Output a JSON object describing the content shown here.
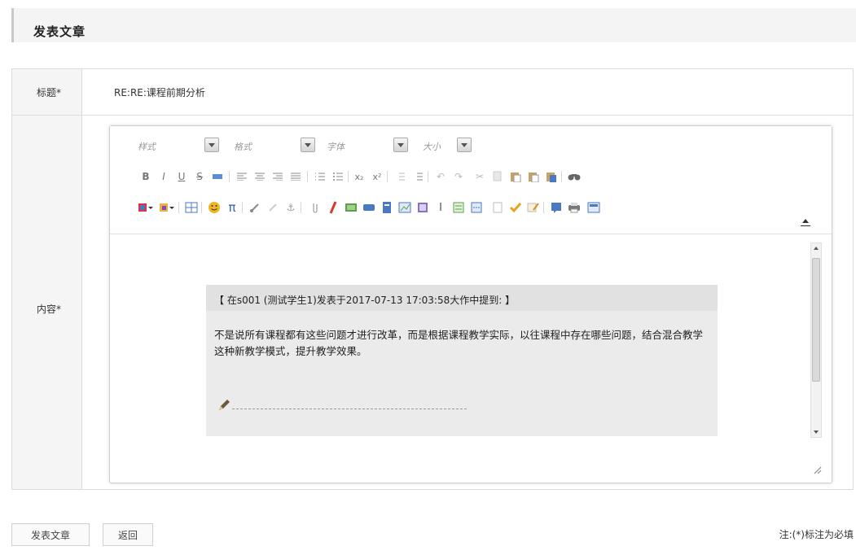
{
  "header": {
    "title": "发表文章"
  },
  "form": {
    "title_label": "标题*",
    "title_value": "RE:RE:课程前期分析",
    "content_label": "内容*"
  },
  "editor": {
    "selects": [
      {
        "label": "样式"
      },
      {
        "label": "格式"
      },
      {
        "label": "字体"
      },
      {
        "label": "大小"
      }
    ],
    "toolbar_row2": [
      "B",
      "I",
      "U",
      "S",
      "x₂",
      "x²"
    ],
    "quote_header": "【 在s001 (测试学生1)发表于2017-07-13 17:03:58大作中提到: 】",
    "quote_body": "不是说所有课程都有这些问题才进行改革，而是根据课程教学实际，以往课程中存在哪些问题，结合混合教学这种新教学模式，提升教学效果。"
  },
  "actions": {
    "publish": "发表文章",
    "back": "返回"
  },
  "note": "注:(*)标注为必填",
  "colors": {
    "quote_bg": "#ebebeb",
    "quote_header_bg": "#e1e1e1",
    "label_bg": "#f5f5f5"
  }
}
